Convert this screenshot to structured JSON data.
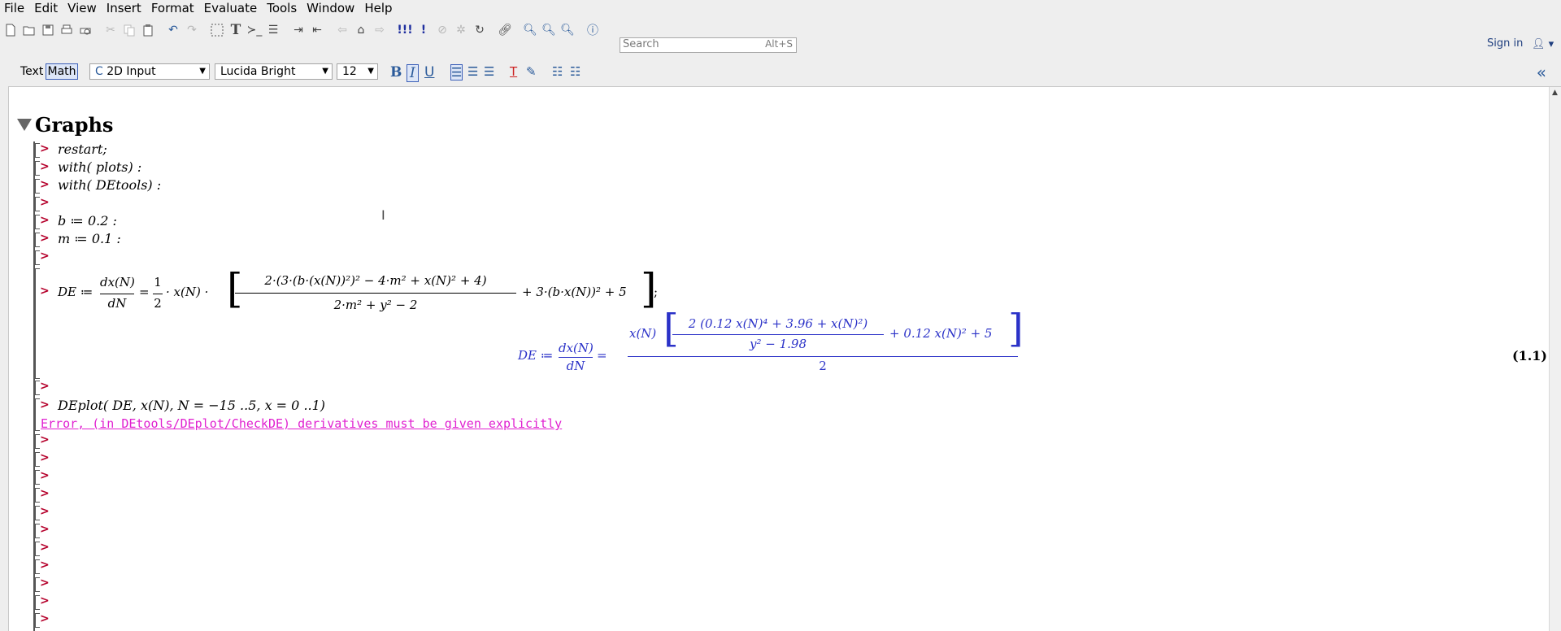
{
  "menu": [
    "File",
    "Edit",
    "View",
    "Insert",
    "Format",
    "Evaluate",
    "Tools",
    "Window",
    "Help"
  ],
  "search": {
    "placeholder": "Search",
    "shortcut": "Alt+S"
  },
  "signin": "Sign in",
  "format_bar": {
    "text_label": "Text",
    "math_label": "Math",
    "input_mode": "2D Input",
    "font": "Lucida Bright",
    "size": "12",
    "bold": "B",
    "italic": "I",
    "underline": "U"
  },
  "section": {
    "title": "Graphs"
  },
  "commands": [
    {
      "pre": "restart;"
    },
    {
      "pre": "with( plots) :"
    },
    {
      "pre": "with( DEtools) :"
    },
    {
      "pre": ""
    },
    {
      "pre": "b ≔ 0.2 :"
    },
    {
      "pre": "m ≔ 0.1 :"
    },
    {
      "pre": ""
    }
  ],
  "de_input": {
    "lhs": "DE ≔",
    "dx": "dx(N)",
    "dN": "dN",
    "eq": "=",
    "half_num": "1",
    "half_den": "2",
    "xN": "· x(N) ·",
    "bracket_num": "2·(3·(b·(x(N))²)² − 4·m² + x(N)² + 4)",
    "bracket_den": "2·m² + y² − 2",
    "tail": "+ 3·(b·x(N))² + 5",
    "end": ";"
  },
  "de_output": {
    "lhs": "DE ≔",
    "dx": "dx(N)",
    "dN": "dN",
    "eq": "=",
    "xN": "x(N)",
    "inner_num": "2 (0.12 x(N)⁴ + 3.96 + x(N)²)",
    "inner_den": "y² − 1.98",
    "tail": "+ 0.12 x(N)² + 5",
    "den": "2",
    "label": "(1.1)"
  },
  "deplot": "DEplot( DE, x(N), N = −15 ..5, x = 0 ..1)",
  "error": "Error, (in DEtools/DEplot/CheckDE) derivatives must be given explicitly"
}
